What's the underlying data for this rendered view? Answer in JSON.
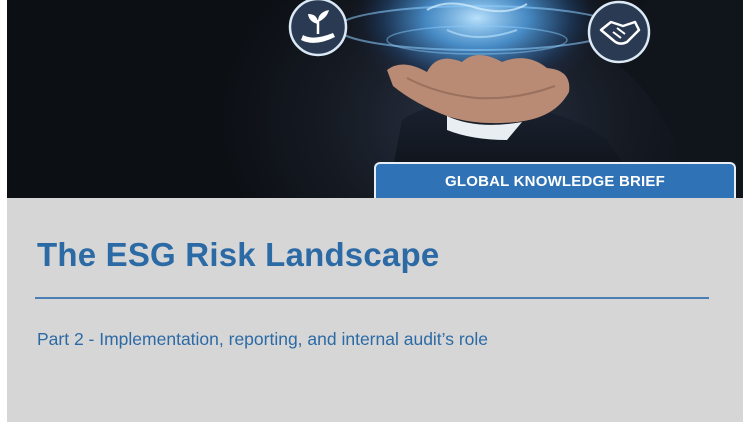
{
  "hero": {
    "image": "hand-holding-glowing-globe-with-esg-icons",
    "icons": [
      "plant-in-hand-icon",
      "globe-icon",
      "handshake-icon"
    ]
  },
  "badge": {
    "label": "GLOBAL KNOWLEDGE BRIEF"
  },
  "title": "The ESG Risk Landscape",
  "subtitle": "Part 2 - Implementation, reporting, and internal audit’s role",
  "colors": {
    "accent": "#2c6aa5",
    "badge_bg": "#2f72b6",
    "panel_bg": "#d6d6d6",
    "hero_bg": "#0c0f14"
  }
}
